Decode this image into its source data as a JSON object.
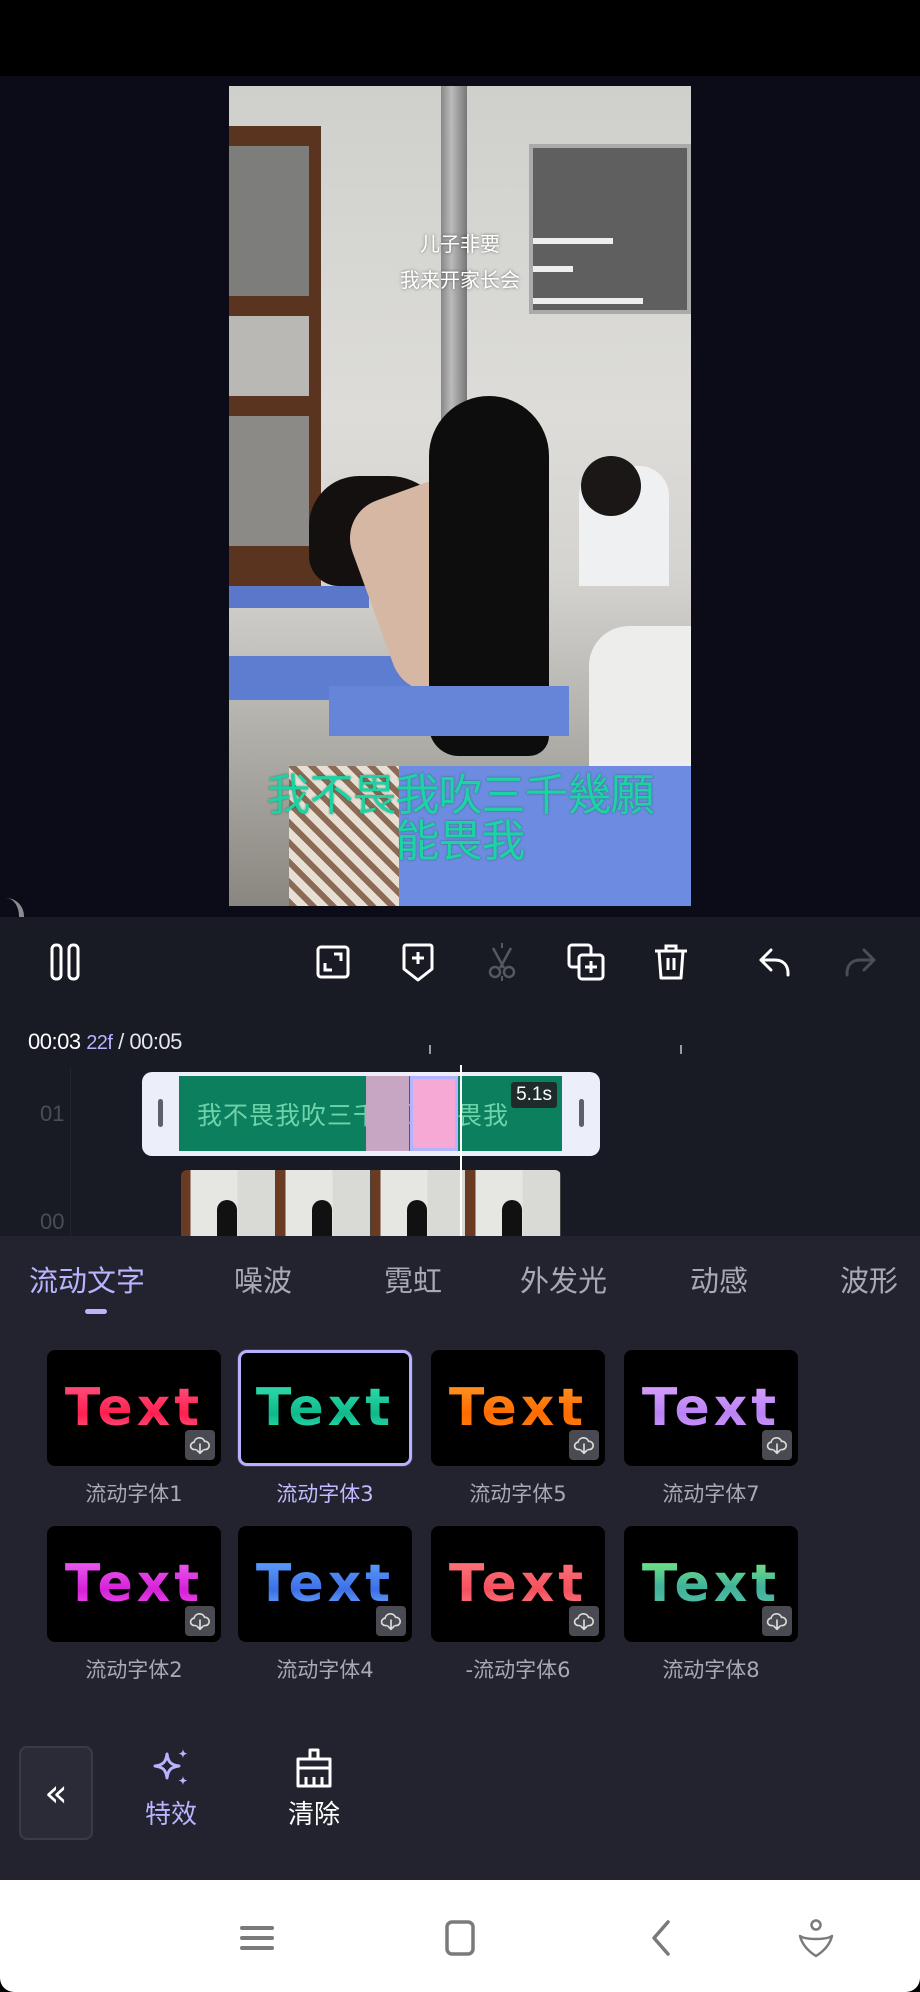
{
  "preview": {
    "overlay_top_line1": "儿子非要",
    "overlay_top_line2": "我来开家长会",
    "subtitle_line1": "我不畏我吹三千幾願",
    "subtitle_line2": "能畏我"
  },
  "toolbar": {
    "pause": "pause-icon",
    "fullscreen": "fullscreen-icon",
    "add_keyframe": "add-keyframe-icon",
    "split": "split-scissors-icon",
    "duplicate": "duplicate-icon",
    "delete": "delete-icon",
    "undo": "undo-icon",
    "redo": "redo-icon",
    "split_enabled": false,
    "redo_enabled": false
  },
  "timeline": {
    "current_time": "00:03",
    "current_frames": "22f",
    "separator": " / ",
    "total_time": "00:05",
    "tracks": [
      {
        "label": "01",
        "type": "text",
        "clip_text": "我不畏我吹三千幾願能畏我",
        "duration": "5.1s",
        "color": "#0c7f5e"
      },
      {
        "label": "00",
        "type": "video"
      }
    ]
  },
  "effects_panel": {
    "tabs": [
      {
        "label": "流动文字",
        "active": true
      },
      {
        "label": "噪波",
        "active": false
      },
      {
        "label": "霓虹",
        "active": false
      },
      {
        "label": "外发光",
        "active": false
      },
      {
        "label": "动感",
        "active": false
      },
      {
        "label": "波形",
        "active": false
      }
    ],
    "fonts": [
      {
        "preview": "Text",
        "label": "流动字体1",
        "selected": false,
        "downloadable": true,
        "gradient": "linear-gradient(180deg,#ff5a86 0%,#ff1f4f 60%,#ff6b95 100%)"
      },
      {
        "preview": "Text",
        "label": "流动字体3",
        "selected": true,
        "downloadable": false,
        "gradient": "linear-gradient(180deg,#36e2b3 0%,#0fb98a 60%,#39e8c0 100%)"
      },
      {
        "preview": "Text",
        "label": "流动字体5",
        "selected": false,
        "downloadable": true,
        "gradient": "linear-gradient(180deg,#ff9c2a 0%,#ff6a00 60%,#ff8a1a 100%)"
      },
      {
        "preview": "Text",
        "label": "流动字体7",
        "selected": false,
        "downloadable": true,
        "gradient": "linear-gradient(180deg,#e0a6ff 0%,#b982f5 60%,#d79bff 100%)"
      },
      {
        "preview": "Text",
        "label": "流动字体2",
        "selected": false,
        "downloadable": true,
        "gradient": "linear-gradient(180deg,#f06bf5 0%,#d520d8 60%,#f05df2 100%)"
      },
      {
        "preview": "Text",
        "label": "流动字体4",
        "selected": false,
        "downloadable": true,
        "gradient": "linear-gradient(180deg,#63a7ff 0%,#3d6fe6 60%,#78b8ff 100%)"
      },
      {
        "preview": "Text",
        "label": "-流动字体6",
        "selected": false,
        "downloadable": true,
        "gradient": "linear-gradient(180deg,#ff7d84 0%,#f4505c 60%,#ff8890 100%)"
      },
      {
        "preview": "Text",
        "label": "流动字体8",
        "selected": false,
        "downloadable": true,
        "gradient": "linear-gradient(180deg,#7ff07a 0%,#3fb29b 55%,#59c4a8 100%)"
      }
    ],
    "collapse_label": "«",
    "actions": [
      {
        "label": "特效",
        "icon": "sparkle-icon",
        "active": true
      },
      {
        "label": "清除",
        "icon": "clear-brush-icon",
        "active": false
      }
    ]
  },
  "navbar": {
    "items": [
      "menu-icon",
      "home-icon",
      "back-icon",
      "assistant-icon"
    ]
  },
  "colors": {
    "accent": "#b9b4ff",
    "panel_bg": "#22232e",
    "toolbar_bg": "#181a24",
    "preview_bg": "#0b0c18",
    "subtitle": "#1dd3a3"
  }
}
